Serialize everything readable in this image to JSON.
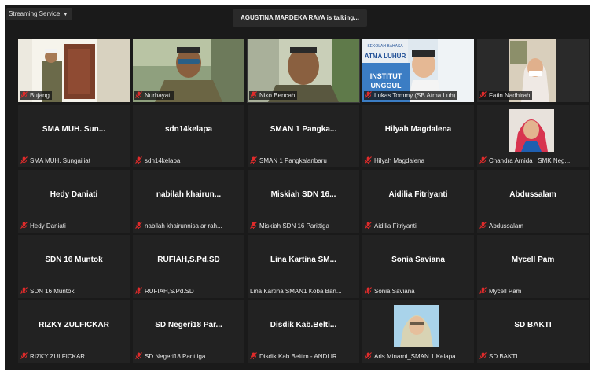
{
  "toolbar": {
    "streaming_label": "Streaming Service",
    "talking_label": "AGUSTINA MARDEKA RAYA is talking..."
  },
  "participants": [
    {
      "display": "",
      "label": "Bujang",
      "video": true,
      "muted": true
    },
    {
      "display": "",
      "label": "Nurhayati",
      "video": true,
      "muted": true
    },
    {
      "display": "",
      "label": "Niko Bencah",
      "video": true,
      "muted": true
    },
    {
      "display": "",
      "label": "Lukas Tommy (SB Atma Luh)",
      "video": true,
      "muted": true,
      "sign_text": [
        "SEKOLAH BAHASA",
        "ATMA LUHUR",
        "INSTITUT",
        "UNGGUL"
      ]
    },
    {
      "display": "",
      "label": "Fatin Nadhirah",
      "video": true,
      "muted": true
    },
    {
      "display": "SMA MUH. Sun...",
      "label": "SMA MUH. Sungailiat",
      "video": false,
      "muted": true
    },
    {
      "display": "sdn14kelapa",
      "label": "sdn14kelapa",
      "video": false,
      "muted": true
    },
    {
      "display": "SMAN 1 Pangka...",
      "label": "SMAN 1 Pangkalanbaru",
      "video": false,
      "muted": true
    },
    {
      "display": "Hilyah Magdalena",
      "label": "Hilyah Magdalena",
      "video": false,
      "muted": true
    },
    {
      "display": "",
      "label": "Chandra Arnida_ SMK Neg...",
      "video": false,
      "avatar": true,
      "muted": true
    },
    {
      "display": "Hedy Daniati",
      "label": "Hedy Daniati",
      "video": false,
      "muted": true
    },
    {
      "display": "nabilah khairun...",
      "label": "nabilah khairunnisa ar rah...",
      "video": false,
      "muted": true
    },
    {
      "display": "Miskiah SDN 16...",
      "label": "Miskiah SDN 16 Parittiga",
      "video": false,
      "muted": true
    },
    {
      "display": "Aidilia Fitriyanti",
      "label": "Aidilia Fitriyanti",
      "video": false,
      "muted": true
    },
    {
      "display": "Abdussalam",
      "label": "Abdussalam",
      "video": false,
      "muted": true
    },
    {
      "display": "SDN 16 Muntok",
      "label": "SDN 16 Muntok",
      "video": false,
      "muted": true
    },
    {
      "display": "RUFIAH,S.Pd.SD",
      "label": "RUFIAH,S.Pd.SD",
      "video": false,
      "muted": true
    },
    {
      "display": "Lina Kartina SM...",
      "label": "Lina Kartina SMAN1 Koba Ban...",
      "video": false,
      "muted": false
    },
    {
      "display": "Sonia Saviana",
      "label": "Sonia Saviana",
      "video": false,
      "muted": true
    },
    {
      "display": "Mycell Pam",
      "label": "Mycell Pam",
      "video": false,
      "muted": true
    },
    {
      "display": "RIZKY ZULFICKAR",
      "label": "RIZKY ZULFICKAR",
      "video": false,
      "muted": true
    },
    {
      "display": "SD Negeri18 Par...",
      "label": "SD Negeri18 Parittiga",
      "video": false,
      "muted": true
    },
    {
      "display": "Disdik Kab.Belti...",
      "label": "Disdik Kab.Beltim - ANDI IR...",
      "video": false,
      "muted": true
    },
    {
      "display": "",
      "label": "Aris Minarni_SMAN 1 Kelapa",
      "video": false,
      "avatar": true,
      "muted": true
    },
    {
      "display": "SD BAKTI",
      "label": "SD BAKTI",
      "video": false,
      "muted": true
    }
  ],
  "colors": {
    "background": "#1a1a1a",
    "tile": "#222222",
    "muted_icon": "#e02b2b",
    "text": "#ffffff"
  },
  "icons": {
    "muted": "microphone-muted-icon",
    "caret": "chevron-down-icon"
  }
}
